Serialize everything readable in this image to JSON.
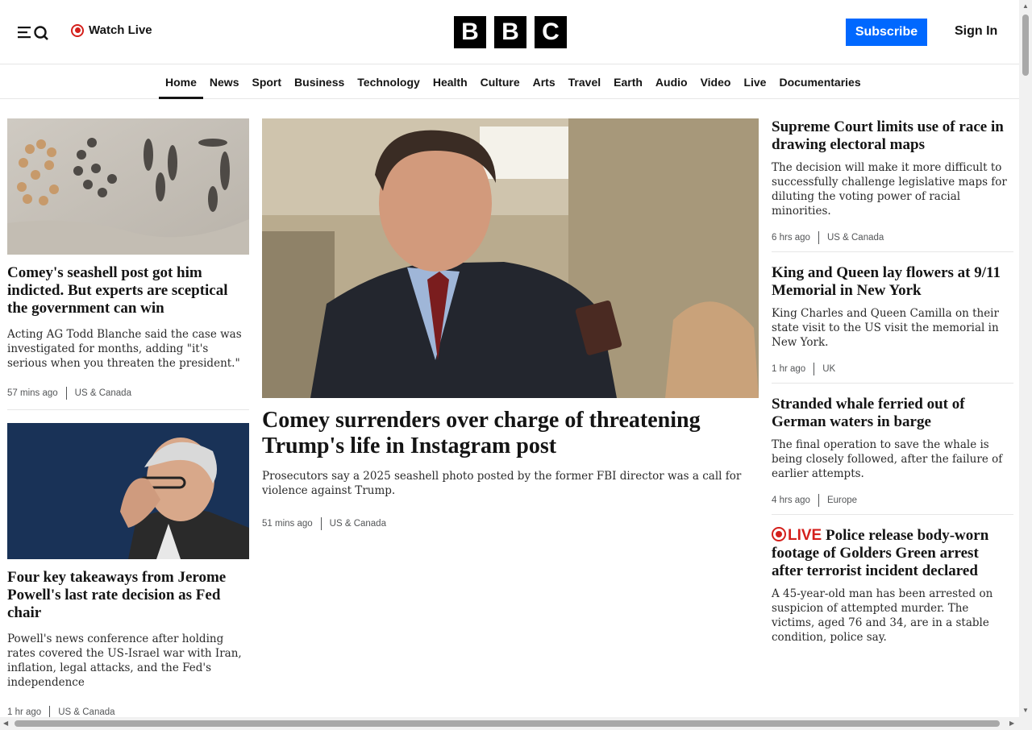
{
  "header": {
    "watch_live_label": "Watch Live",
    "logo_letters": [
      "B",
      "B",
      "C"
    ],
    "subscribe_label": "Subscribe",
    "signin_label": "Sign In"
  },
  "nav": {
    "items": [
      "Home",
      "News",
      "Sport",
      "Business",
      "Technology",
      "Health",
      "Culture",
      "Arts",
      "Travel",
      "Earth",
      "Audio",
      "Video",
      "Live",
      "Documentaries"
    ],
    "active": "Home"
  },
  "left": {
    "story1": {
      "headline": "Comey's seashell post got him indicted. But experts are sceptical the government can win",
      "summary": "Acting AG Todd Blanche said the case was investigated for months, adding \"it's serious when you threaten the president.\"",
      "time": "57 mins ago",
      "section": "US & Canada",
      "image_text": "8647"
    },
    "story2": {
      "headline": "Four key takeaways from Jerome Powell's last rate decision as Fed chair",
      "summary": "Powell's news conference after holding rates covered the US-Israel war with Iran, inflation, legal attacks, and the Fed's independence",
      "time": "1 hr ago",
      "section": "US & Canada"
    }
  },
  "main": {
    "headline": "Comey surrenders over charge of threatening Trump's life in Instagram post",
    "summary": "Prosecutors say a 2025 seashell photo posted by the former FBI director was a call for violence against Trump.",
    "time": "51 mins ago",
    "section": "US & Canada"
  },
  "right": {
    "story1": {
      "headline": "Supreme Court limits use of race in drawing electoral maps",
      "summary": "The decision will make it more difficult to successfully challenge legislative maps for diluting the voting power of racial minorities.",
      "time": "6 hrs ago",
      "section": "US & Canada"
    },
    "story2": {
      "headline": "King and Queen lay flowers at 9/11 Memorial in New York",
      "summary": "King Charles and Queen Camilla on their state visit to the US visit the memorial in New York.",
      "time": "1 hr ago",
      "section": "UK"
    },
    "story3": {
      "headline": "Stranded whale ferried out of German waters in barge",
      "summary": "The final operation to save the whale is being closely followed, after the failure of earlier attempts.",
      "time": "4 hrs ago",
      "section": "Europe"
    },
    "story4": {
      "live_tag": "LIVE",
      "headline": "Police release body-worn footage of Golders Green arrest after terrorist incident declared",
      "summary": "A 45-year-old man has been arrested on suspicion of attempted murder. The victims, aged 76 and 34, are in a stable condition, police say."
    }
  },
  "colors": {
    "brand_blue": "#0068ff",
    "live_red": "#d4201c",
    "text": "#141414"
  }
}
